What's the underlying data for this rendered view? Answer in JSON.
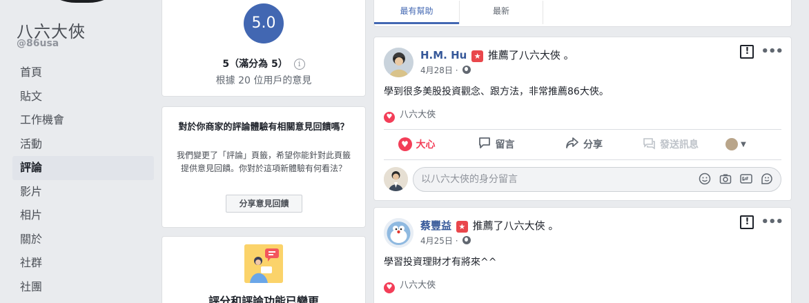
{
  "page": {
    "name": "八六大俠",
    "handle": "@86usa"
  },
  "nav": {
    "items": [
      {
        "label": "首頁",
        "active": false
      },
      {
        "label": "貼文",
        "active": false
      },
      {
        "label": "工作機會",
        "active": false
      },
      {
        "label": "活動",
        "active": false
      },
      {
        "label": "評論",
        "active": true
      },
      {
        "label": "影片",
        "active": false
      },
      {
        "label": "相片",
        "active": false
      },
      {
        "label": "關於",
        "active": false
      },
      {
        "label": "社群",
        "active": false
      },
      {
        "label": "社團",
        "active": false
      }
    ]
  },
  "rating": {
    "score": "5.0",
    "summary": "5（滿分為 5）",
    "info_glyph": "i",
    "based_on": "根據 20 位用戶的意見"
  },
  "feedback": {
    "title": "對於你商家的評論體驗有相關意見回饋嗎？",
    "body": "我們變更了「評論」頁籤，希望你能針對此頁籤提供意見回饋。你對於這項新體驗有何看法？",
    "button": "分享意見回饋"
  },
  "changed": {
    "title": "評分和評論功能已變更"
  },
  "tabs": {
    "most_helpful": "最有幫助",
    "latest": "最新"
  },
  "posts": [
    {
      "author": "H.M. Hu",
      "verb": "推薦了八六大俠 。",
      "date": "4月28日",
      "separator": "·",
      "text": "學到很多美股投資觀念、跟方法，非常推薦86大俠。",
      "liked_by": "八六大俠",
      "actions": {
        "love": "大心",
        "comment": "留言",
        "share": "分享",
        "message": "發送訊息"
      },
      "comment_placeholder": "以八六大俠的身分留言"
    },
    {
      "author": "蔡豐益",
      "verb": "推薦了八六大俠 。",
      "date": "4月25日",
      "separator": "·",
      "text": "學習投資理財才有將來^^",
      "liked_by": "八六大俠"
    }
  ],
  "icons": {
    "report": "flag-report-icon",
    "more": "more-options-icon",
    "globe": "globe-icon",
    "emoji": "emoji-icon",
    "camera": "camera-icon",
    "gif": "gif-icon",
    "sticker": "sticker-icon"
  },
  "colors": {
    "brand": "#4267b2",
    "link": "#365899",
    "love": "#f33e58",
    "badge": "#e9474c"
  }
}
